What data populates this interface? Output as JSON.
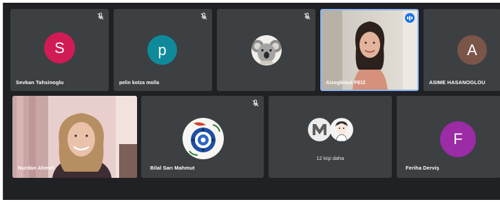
{
  "meeting": {
    "participants": [
      {
        "id": "p1",
        "name": "Sevkan Tahsinoglu",
        "initial": "S",
        "color": "#d11b54",
        "muted": true
      },
      {
        "id": "p2",
        "name": "pelin kotza molla",
        "initial": "p",
        "color": "#0e8a9a",
        "muted": true
      },
      {
        "id": "p3",
        "name": "",
        "muted": true,
        "avatar_type": "koala-photo"
      },
      {
        "id": "p4",
        "name": "Aisegkioul FEIZ",
        "muted": false,
        "speaking": true,
        "video": true
      },
      {
        "id": "p5",
        "name": "ASIME HASANOGLOU",
        "initial": "A",
        "color": "#7a5548",
        "muted": false
      },
      {
        "id": "p6",
        "name": "Nurdan Ahmet",
        "muted": false,
        "video": true
      },
      {
        "id": "p7",
        "name": "Bilal Sarı Mahmut",
        "muted": true,
        "avatar_type": "tile-art-photo"
      },
      {
        "id": "p8",
        "more_label": "12 kişi daha"
      },
      {
        "id": "p9",
        "name": "Feriha Derviş",
        "initial": "F",
        "color": "#9c2ba6",
        "muted": false
      }
    ]
  },
  "colors": {
    "stage_bg": "#202124",
    "tile_bg": "#3c4043",
    "active_speaker_border": "#8ab4f8",
    "speaking_badge": "#1a73e8"
  },
  "icons": {
    "muted": "mic-off-icon",
    "speaking": "audio-level-icon"
  }
}
